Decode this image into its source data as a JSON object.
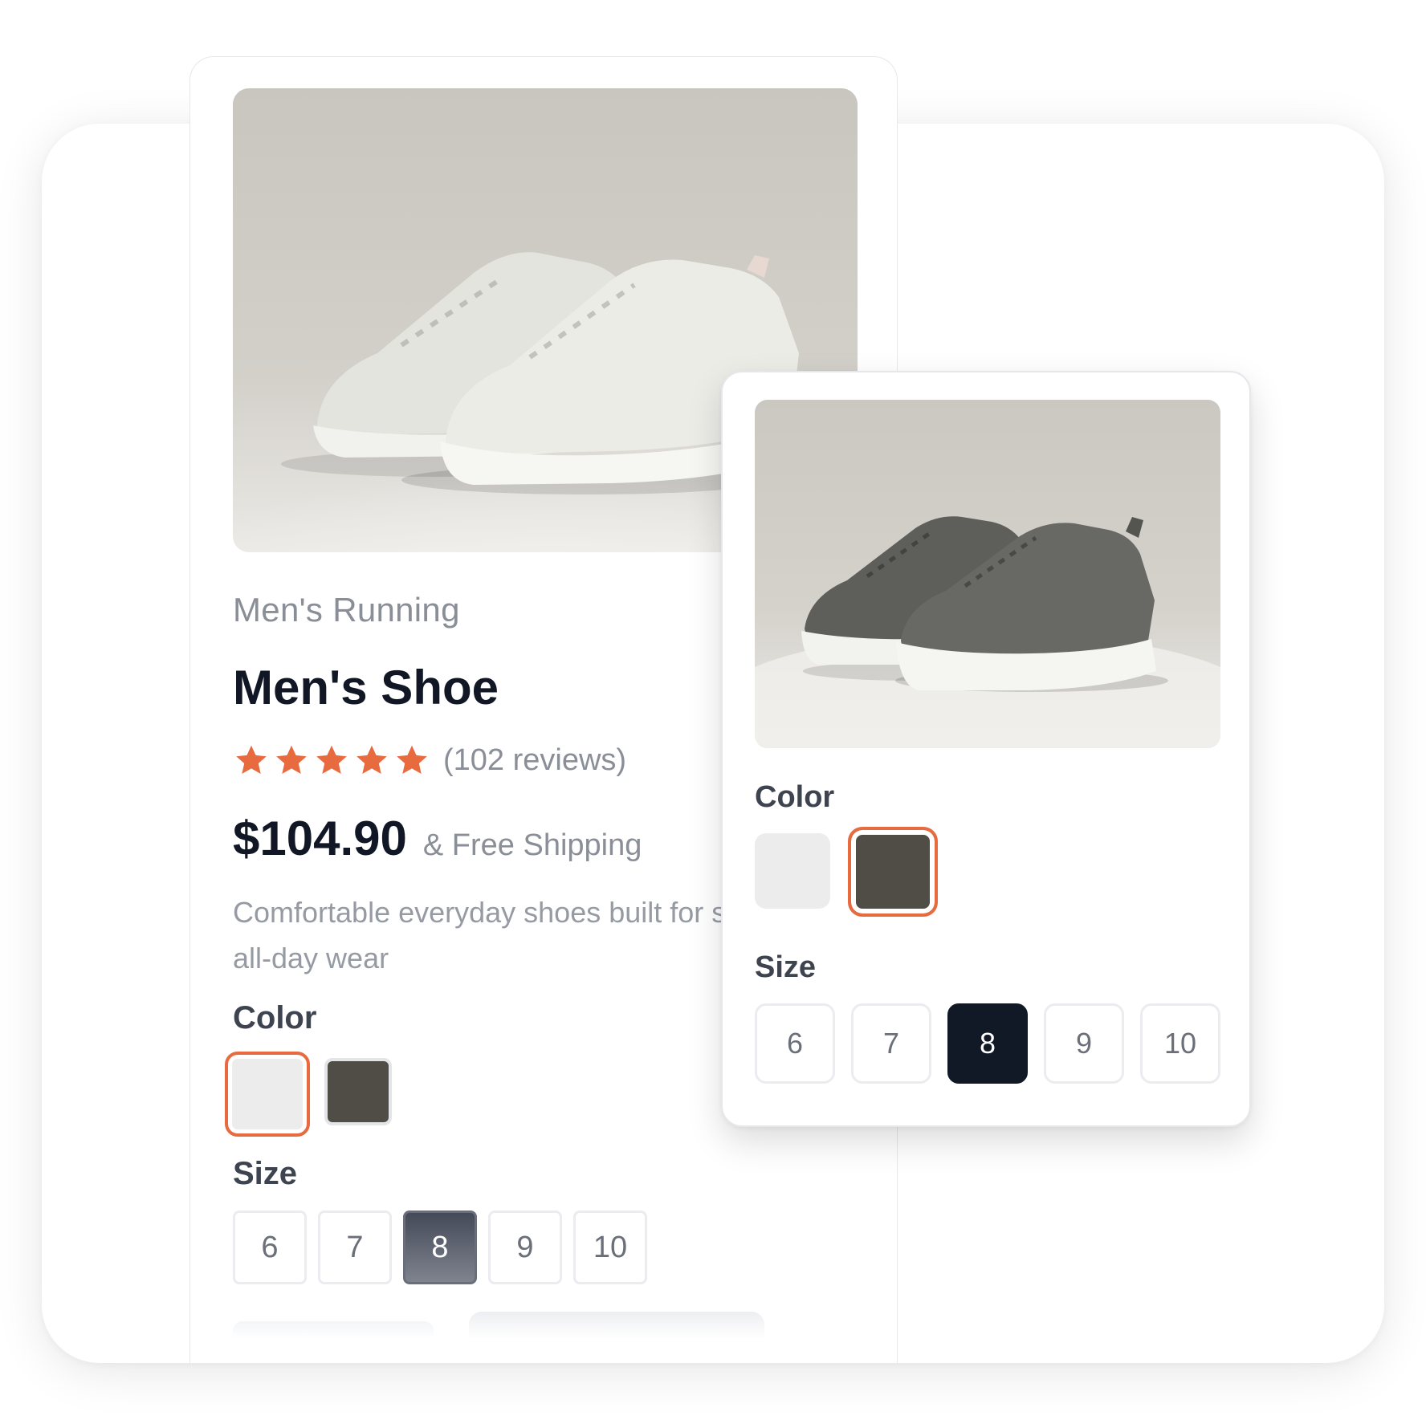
{
  "product": {
    "category": "Men's Running",
    "title": "Men's Shoe",
    "rating_stars": 5,
    "reviews": "(102 reviews)",
    "price": "$104.90",
    "shipping": "& Free Shipping",
    "description": "Comfortable everyday shoes built for style and all-day wear"
  },
  "options": {
    "color_label": "Color",
    "size_label": "Size",
    "colors": [
      {
        "name": "light",
        "hex": "#ececec"
      },
      {
        "name": "dark",
        "hex": "#4f4d46"
      }
    ],
    "sizes": [
      "6",
      "7",
      "8",
      "9",
      "10"
    ]
  },
  "main_panel": {
    "selected_color": "light",
    "selected_size": "8"
  },
  "detail_card": {
    "selected_color": "dark",
    "selected_size": "8"
  },
  "colors": {
    "accent": "#e86a3f",
    "heading": "#121726",
    "muted": "#8a8e97",
    "selected_size_bg": "#111826"
  },
  "icons": {
    "star": "star-icon"
  }
}
